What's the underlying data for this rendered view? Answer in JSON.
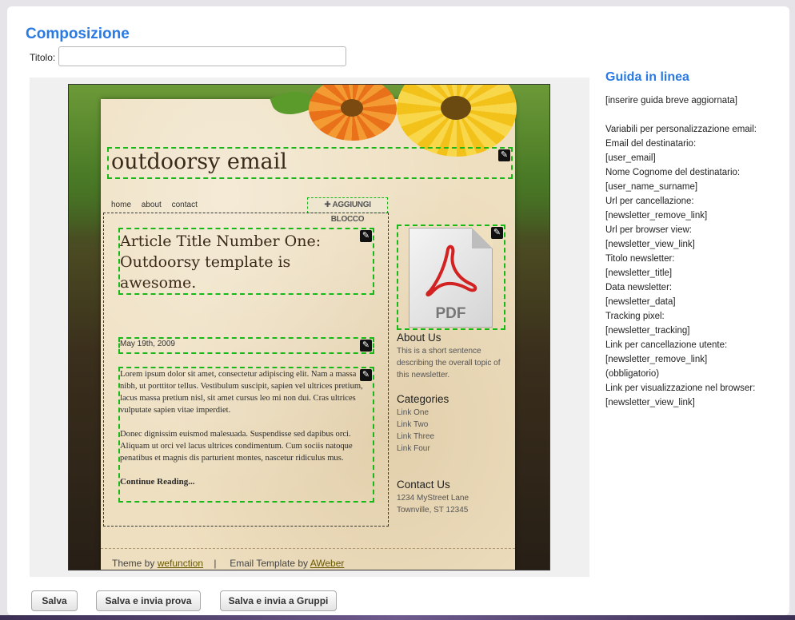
{
  "page": {
    "title": "Composizione"
  },
  "form": {
    "title_label": "Titolo:",
    "title_value": "",
    "title_placeholder": ""
  },
  "template": {
    "header_title": "outdoorsy email",
    "nav": [
      "home",
      "about",
      "contact"
    ],
    "add_block_label": "✚ AGGIUNGI BLOCCO",
    "article": {
      "title": "Article Title Number One: Outdoorsy template is awesome.",
      "date": "May 19th, 2009",
      "paragraphs": [
        "Lorem ipsum dolor sit amet, consectetur adipiscing elit. Nam a massa nibh, ut porttitor tellus. Vestibulum suscipit, sapien vel ultrices pretium, lacus massa pretium nisl, sit amet cursus leo mi non dui. Cras ultrices vulputate sapien vitae imperdiet.",
        "Donec dignissim euismod malesuada. Suspendisse sed dapibus orci. Aliquam ut orci vel lacus ultrices condimentum. Cum sociis natoque penatibus et magnis dis parturient montes, nascetur ridiculus mus."
      ],
      "read_more": "Continue Reading..."
    },
    "pdf_label": "PDF",
    "about": {
      "heading": "About Us",
      "text": "This is a short sentence describing the overall topic of this newsletter."
    },
    "categories": {
      "heading": "Categories",
      "links": [
        "Link One",
        "Link Two",
        "Link Three",
        "Link Four"
      ]
    },
    "contact": {
      "heading": "Contact Us",
      "line1": "1234 MyStreet Lane",
      "line2": "Townville, ST 12345"
    },
    "footer": {
      "theme_prefix": "Theme by ",
      "theme_link": "wefunction",
      "separator": "|",
      "tpl_prefix": "Email Template by ",
      "tpl_link": "AWeber"
    }
  },
  "guide": {
    "title": "Guida in linea",
    "text": "[inserire guida breve aggiornata]\n\nVariabili per personalizzazione email:\nEmail del destinatario:\n[user_email]\nNome Cognome del destinatario:\n[user_name_surname]\nUrl per cancellazione:\n[newsletter_remove_link]\nUrl per browser view:\n[newsletter_view_link]\nTitolo newsletter:\n[newsletter_title]\nData newsletter:\n[newsletter_data]\nTracking pixel:\n[newsletter_tracking]\nLink per cancellazione utente:\n[newsletter_remove_link]\n(obbligatorio)\nLink per visualizzazione nel browser: [newsletter_view_link]"
  },
  "buttons": {
    "save": "Salva",
    "save_test": "Salva e invia prova",
    "save_groups": "Salva e invia a Gruppi"
  },
  "icons": {
    "edit": "pencil-edit-icon",
    "pdf": "pdf-file-icon"
  },
  "colors": {
    "accent": "#2a7ae2",
    "block_outline": "#19b819"
  }
}
